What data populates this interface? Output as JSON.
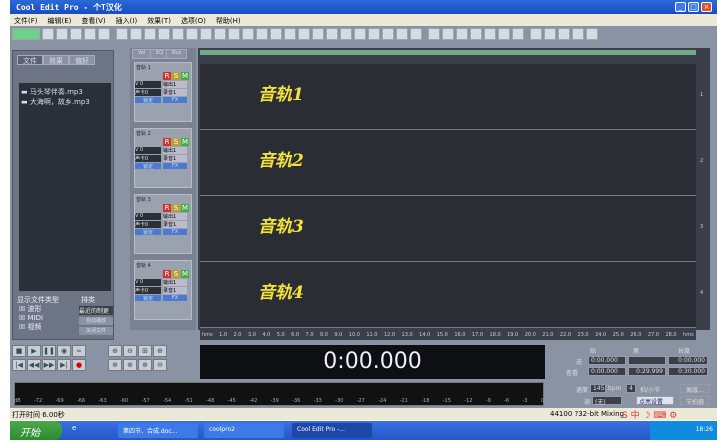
{
  "title": "Cool Edit Pro  - 个T汉化",
  "menu": [
    "文件(F)",
    "编辑(E)",
    "查看(V)",
    "插入(I)",
    "效果(T)",
    "选项(O)",
    "帮助(H)"
  ],
  "left_tabs": [
    "文件",
    "效果",
    "偏好"
  ],
  "files": [
    "马头琴伴奏.mp3",
    "大海啊，故乡.mp3"
  ],
  "show_types_label": "显示文件类型",
  "sort_label": "排类",
  "types": [
    "波形",
    "MIDI",
    "视频"
  ],
  "sort_value": "最近的制更",
  "auto_play": "自动播放",
  "close_file": "关闭文件",
  "track_tabs": [
    "Vol",
    "EQ",
    "Bus"
  ],
  "tracks": [
    {
      "name": "音轨 1",
      "label": "音轨1",
      "num": "1"
    },
    {
      "name": "音轨 2",
      "label": "音轨2",
      "num": "2"
    },
    {
      "name": "音轨 3",
      "label": "音轨3",
      "num": "3"
    },
    {
      "name": "音轨 4",
      "label": "音轨4",
      "num": "4"
    }
  ],
  "track_ctrl": {
    "r": "R",
    "s": "S",
    "m": "M",
    "vol": "V 0",
    "out": "输出1",
    "rec": "录音1",
    "dev": "声卡0",
    "lock": "锁定",
    "fx": "FX"
  },
  "ruler": [
    "hms",
    "1.0",
    "2.0",
    "3.0",
    "4.0",
    "5.0",
    "6.0",
    "7.0",
    "8.0",
    "9.0",
    "10.0",
    "11.0",
    "12.0",
    "13.0",
    "14.0",
    "15.0",
    "16.0",
    "17.0",
    "18.0",
    "19.0",
    "20.0",
    "21.0",
    "22.0",
    "23.0",
    "24.0",
    "25.0",
    "26.0",
    "27.0",
    "28.0",
    "hms"
  ],
  "time_display": "0:00.000",
  "time_panel": {
    "begin": "始",
    "end": "尾",
    "length": "长度",
    "sel": "选",
    "view": "查看",
    "sel_begin": "0:00.000",
    "sel_end": "",
    "sel_len": "0:00.000",
    "view_begin": "0:00.000",
    "view_end": "0:29.999",
    "view_len": "0:30.000"
  },
  "tempo": {
    "label": "速度",
    "value": "145",
    "unit": "bpm",
    "beats": "4",
    "beats_label": "拍/小节",
    "key_label": "调",
    "key": "(无)",
    "metronome": "点亮设置",
    "advanced": "高级...",
    "metro_btn": "节拍器"
  },
  "meter_scale": [
    "dB",
    "-72",
    "-69",
    "-66",
    "-63",
    "-60",
    "-57",
    "-54",
    "-51",
    "-48",
    "-45",
    "-42",
    "-39",
    "-36",
    "-33",
    "-30",
    "-27",
    "-24",
    "-21",
    "-18",
    "-15",
    "-12",
    "-9",
    "-6",
    "-3",
    "0"
  ],
  "status": {
    "open_time": "打开时间 6.00秒",
    "format": "44100 ?32-bit Mixing"
  },
  "taskbar": {
    "start": "开始",
    "items": [
      "第四节、合成.doc...",
      "coolpro2",
      "Cool Edit Pro -..."
    ],
    "clock": "18:26"
  }
}
